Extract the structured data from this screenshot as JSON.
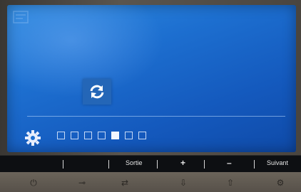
{
  "osd": {
    "icons": {
      "top_left": "menu-icon",
      "center": "refresh-icon",
      "settings": "gear-icon"
    },
    "option_dots": {
      "count": 7,
      "selected_index": 4
    }
  },
  "buttons": {
    "labels": [
      "",
      "",
      "Sortie",
      "+",
      "–",
      "Suivant"
    ],
    "hardware_icons": [
      "power-icon",
      "key-icon",
      "input-icon",
      "down-arrow-icon",
      "up-arrow-icon",
      "settings-icon"
    ]
  },
  "colors": {
    "screen_blue": "#1d6fd0",
    "tile_blue": "#2466b7",
    "bar_black": "#0d0f12"
  }
}
